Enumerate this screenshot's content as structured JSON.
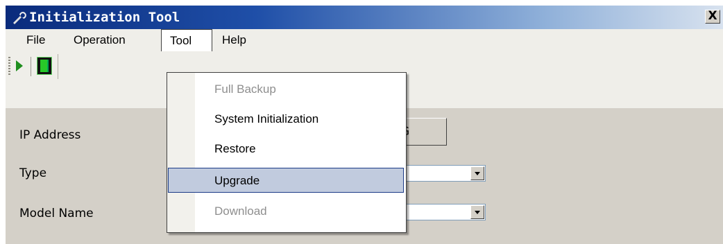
{
  "window": {
    "title": "Initialization Tool",
    "close_glyph": "X"
  },
  "menubar": {
    "items": [
      "File",
      "Operation",
      "Tool",
      "Help"
    ],
    "open": "Tool"
  },
  "toolbar": {
    "buttons": [
      {
        "icon": "play-icon"
      },
      {
        "icon": "exit-door-icon"
      }
    ]
  },
  "form": {
    "ip_label": "IP Address",
    "ip_button_text": "G",
    "type_label": "Type",
    "model_label": "Model Name"
  },
  "tool_menu": {
    "items": [
      {
        "label": "Full Backup",
        "enabled": false
      },
      {
        "label": "System Initialization",
        "enabled": true
      },
      {
        "label": "Restore",
        "enabled": true
      },
      {
        "label": "Upgrade",
        "enabled": true,
        "highlighted": true
      },
      {
        "label": "Download",
        "enabled": false
      }
    ]
  },
  "colors": {
    "title_start": "#0a2b7c",
    "menu_highlight": "#c1cbde",
    "disabled_text": "#8e8e8e"
  }
}
